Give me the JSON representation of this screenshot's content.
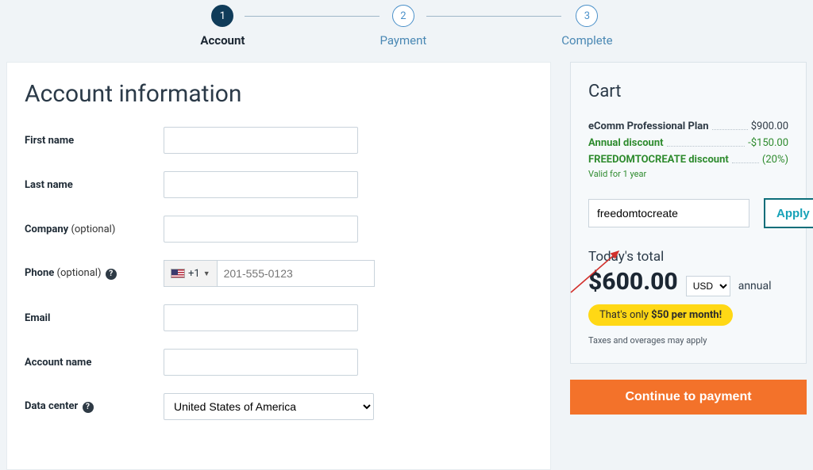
{
  "stepper": {
    "steps": [
      {
        "num": "1",
        "label": "Account"
      },
      {
        "num": "2",
        "label": "Payment"
      },
      {
        "num": "3",
        "label": "Complete"
      }
    ]
  },
  "account": {
    "heading": "Account information",
    "first_name_label": "First name",
    "last_name_label": "Last name",
    "company_label": "Company",
    "company_optional": " (optional)",
    "phone_label": "Phone",
    "phone_optional": " (optional)",
    "phone_cc": "+1",
    "phone_placeholder": "201-555-0123",
    "email_label": "Email",
    "account_name_label": "Account name",
    "data_center_label": "Data center",
    "data_center_value": "United States of America",
    "help_glyph": "?"
  },
  "cart": {
    "heading": "Cart",
    "plan_label": "eComm Professional Plan",
    "plan_price": "$900.00",
    "annual_discount_label": "Annual discount",
    "annual_discount_value": "-$150.00",
    "promo_discount_label": "FREEDOMTOCREATE discount",
    "promo_discount_value": "(20%)",
    "valid_note": "Valid for 1 year",
    "promo_code_value": "freedomtocreate",
    "apply_label": "Apply",
    "total_label": "Today's total",
    "total_amount": "$600.00",
    "currency": "USD",
    "annual_text": "annual",
    "badge_prefix": "That's only ",
    "badge_bold": "$50 per month!",
    "tax_note": "Taxes and overages may apply"
  },
  "continue_label": "Continue to payment"
}
